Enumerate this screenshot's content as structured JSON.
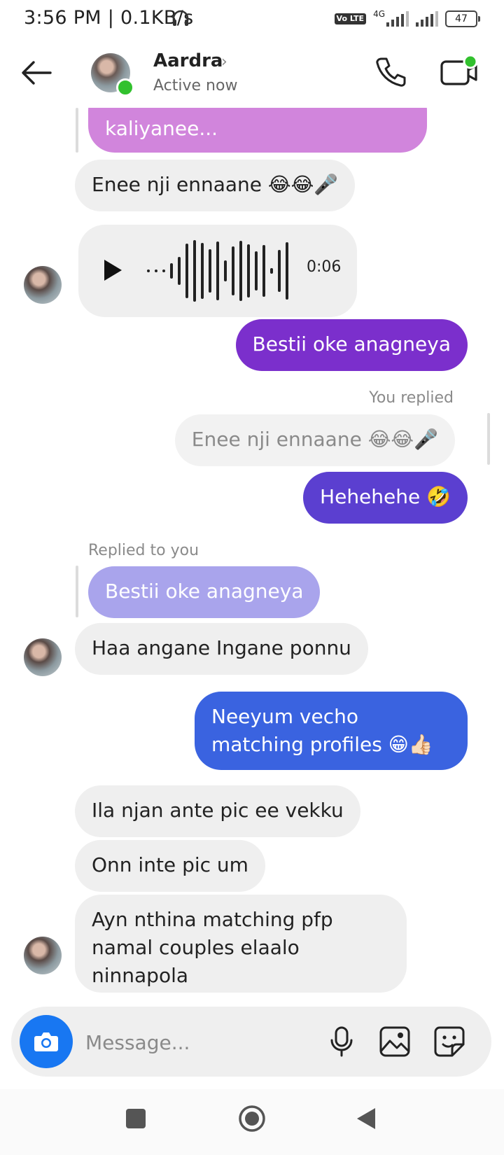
{
  "status_bar": {
    "time": "3:56 PM | 0.1KB/s",
    "volte": "Vo LTE",
    "network_type": "4G",
    "battery": "47"
  },
  "header": {
    "name": "Aardra",
    "chevron": "›",
    "status": "Active now",
    "icons": [
      "back-arrow-icon",
      "phone-icon",
      "video-call-icon"
    ]
  },
  "messages": {
    "quoted_top_line2": "kaliyanee...",
    "m1": "Enee nji ennaane 😂😂🎤",
    "voice_duration": "0:06",
    "m2": "Bestii oke anagneya",
    "you_replied": "You replied",
    "quoted_reply": "Enee nji ennaane 😂😂🎤",
    "m3": "Hehehehe 🤣",
    "replied_to_you": "Replied to you",
    "quoted_bestii": "Bestii oke anagneya",
    "m4": "Haa angane Ingane ponnu",
    "m5": "Neeyum vecho matching profiles 😁👍🏻",
    "m6": "Ila njan ante pic ee vekku",
    "m7": "Onn inte pic um",
    "m8": "Ayn nthina matching pfp namal couples elaalo ninnapola"
  },
  "composer": {
    "placeholder": "Message..."
  },
  "colors": {
    "accent_blue": "#1877f2",
    "online": "#32c12e",
    "bubble_purple": "#7b2fcc",
    "bubble_indigo": "#5b3fd0",
    "bubble_blue": "#3a63e0"
  }
}
